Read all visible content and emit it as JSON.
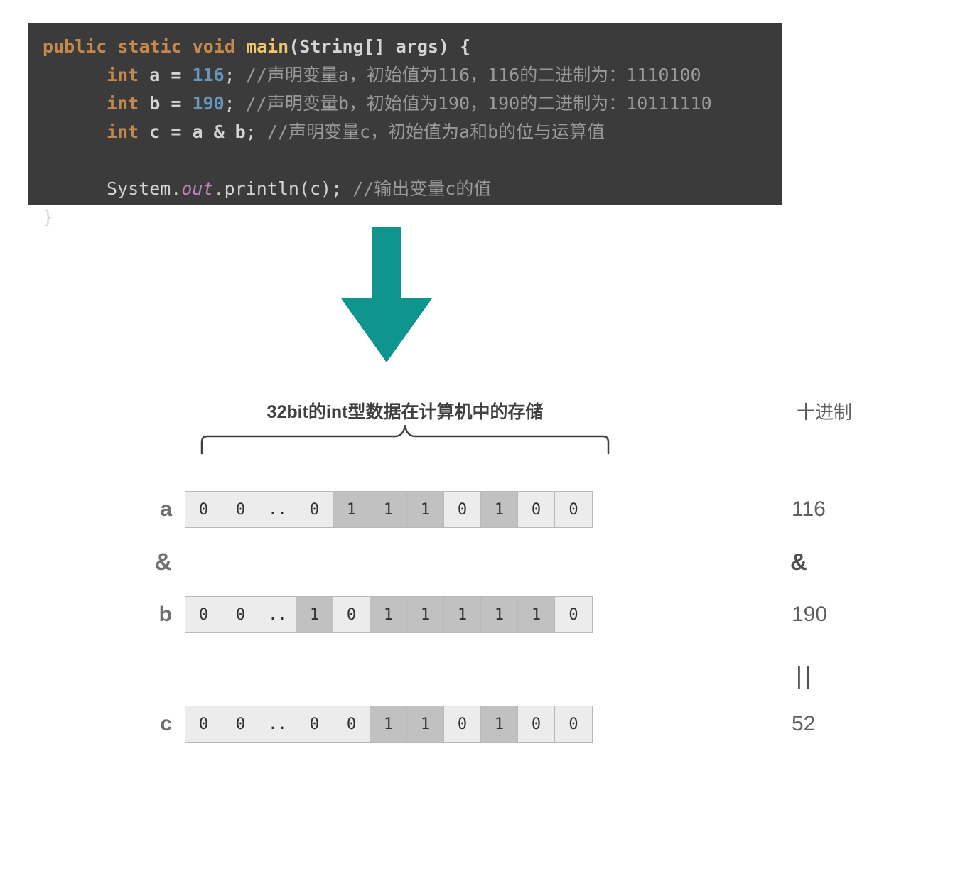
{
  "code": {
    "line1": {
      "public": "public",
      "static": "static",
      "void": "void",
      "main": "main",
      "args": "(String[] args) {"
    },
    "line2": {
      "int": "int",
      "var": "a",
      "eq": "=",
      "val": "116",
      "semi": ";",
      "comment": "//声明变量a，初始值为116，116的二进制为：1110100"
    },
    "line3": {
      "int": "int",
      "var": "b",
      "eq": "=",
      "val": "190",
      "semi": ";",
      "comment": "//声明变量b，初始值为190，190的二进制为：10111110"
    },
    "line4": {
      "int": "int",
      "var": "c",
      "eq": "=",
      "expr": "a & b",
      "semi": ";",
      "comment": "//声明变量c，初始值为a和b的位与运算值"
    },
    "line5": {
      "pre": "System.",
      "out": "out",
      "post": ".println(c);",
      "comment": "//输出变量c的值"
    },
    "line6": "}"
  },
  "diagram": {
    "brace_label": "32bit的int型数据在计算机中的存储",
    "dec_label": "十进制",
    "rows": {
      "a": {
        "label": "a",
        "bits": [
          "0",
          "0",
          "..",
          "0",
          "1",
          "1",
          "1",
          "0",
          "1",
          "0",
          "0"
        ],
        "dec": "116"
      },
      "op": {
        "label": "&",
        "dec": "&"
      },
      "b": {
        "label": "b",
        "bits": [
          "0",
          "0",
          "..",
          "1",
          "0",
          "1",
          "1",
          "1",
          "1",
          "1",
          "0"
        ],
        "dec": "190"
      },
      "eq": {
        "symbol": "||"
      },
      "c": {
        "label": "c",
        "bits": [
          "0",
          "0",
          "..",
          "0",
          "0",
          "1",
          "1",
          "0",
          "1",
          "0",
          "0"
        ],
        "dec": "52"
      }
    }
  }
}
